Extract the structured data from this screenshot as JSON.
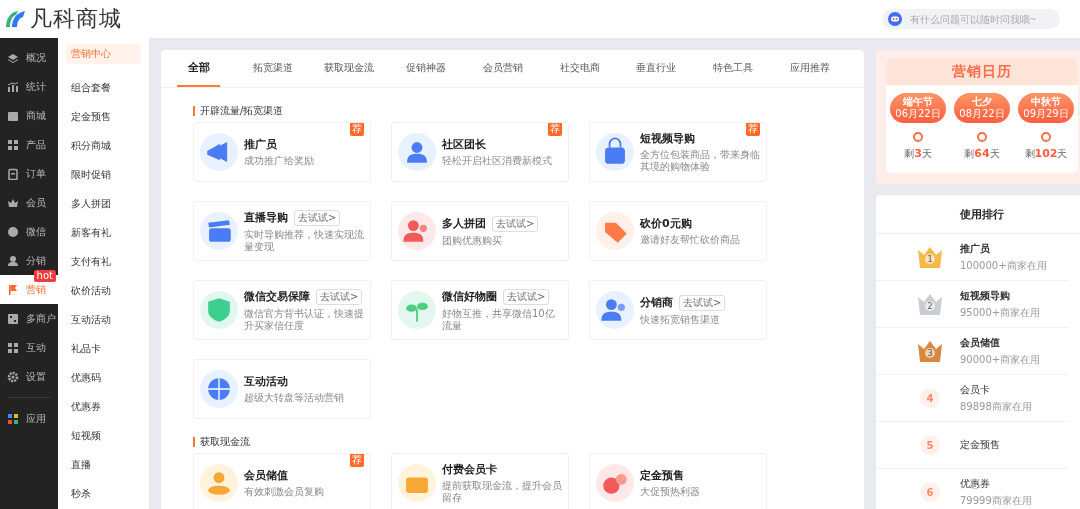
{
  "header": {
    "logo_text": "凡科商城",
    "search": {
      "placeholder": "有什么问题可以随时问我哦~"
    }
  },
  "nav": [
    {
      "label": "概况",
      "selected": false
    },
    {
      "label": "统计",
      "selected": false
    },
    {
      "label": "商城",
      "selected": false
    },
    {
      "label": "产品",
      "selected": false
    },
    {
      "label": "订单",
      "selected": false
    },
    {
      "label": "会员",
      "selected": false
    },
    {
      "label": "微信",
      "selected": false
    },
    {
      "label": "分销",
      "selected": false
    },
    {
      "label": "营销",
      "selected": true,
      "badge": "hot"
    },
    {
      "label": "多商户",
      "selected": false
    },
    {
      "label": "互动",
      "selected": false
    },
    {
      "label": "设置",
      "selected": false
    },
    {
      "label": "应用",
      "selected": false
    }
  ],
  "submenu": [
    {
      "label": "营销中心",
      "selected": true
    },
    {
      "label": "组合套餐",
      "selected": false
    },
    {
      "label": "定金预售",
      "selected": false
    },
    {
      "label": "积分商城",
      "selected": false
    },
    {
      "label": "限时促销",
      "selected": false
    },
    {
      "label": "多人拼团",
      "selected": false
    },
    {
      "label": "新客有礼",
      "selected": false
    },
    {
      "label": "支付有礼",
      "selected": false
    },
    {
      "label": "砍价活动",
      "selected": false
    },
    {
      "label": "互动活动",
      "selected": false
    },
    {
      "label": "礼品卡",
      "selected": false
    },
    {
      "label": "优惠码",
      "selected": false
    },
    {
      "label": "优惠券",
      "selected": false
    },
    {
      "label": "短视频",
      "selected": false
    },
    {
      "label": "直播",
      "selected": false
    },
    {
      "label": "秒杀",
      "selected": false
    }
  ],
  "tabs": [
    {
      "label": "全部",
      "selected": true
    },
    {
      "label": "拓宽渠道",
      "selected": false
    },
    {
      "label": "获取现金流",
      "selected": false
    },
    {
      "label": "促销神器",
      "selected": false
    },
    {
      "label": "会员营销",
      "selected": false
    },
    {
      "label": "社交电商",
      "selected": false
    },
    {
      "label": "垂直行业",
      "selected": false
    },
    {
      "label": "特色工具",
      "selected": false
    },
    {
      "label": "应用推荐",
      "selected": false
    }
  ],
  "sections": [
    {
      "title": "开辟流量/拓宽渠道",
      "cards": [
        {
          "title": "推广员",
          "description": "成功推广给奖励",
          "badge": "荐"
        },
        {
          "title": "社区团长",
          "description": "轻松开启社区消费新模式",
          "badge": "荐"
        },
        {
          "title": "短视频导购",
          "description": "全方位包装商品，带来身临其境的购物体验",
          "badge": "荐"
        },
        {
          "title": "直播导购",
          "description": "实时导购推荐，快速实现流量变现",
          "try_button": "去试试>"
        },
        {
          "title": "多人拼团",
          "description": "团购优惠购买",
          "try_button": "去试试>"
        },
        {
          "title": "砍价0元购",
          "description": "邀请好友帮忙砍价商品"
        },
        {
          "title": "微信交易保障",
          "description": "微信官方背书认证，快速提升买家信任度",
          "try_button": "去试试>"
        },
        {
          "title": "微信好物圈",
          "description": "好物互推，共享微信10亿流量",
          "try_button": "去试试>"
        },
        {
          "title": "分销商",
          "description": "快速拓宽销售渠道",
          "try_button": "去试试>"
        },
        {
          "title": "互动活动",
          "description": "超级大转盘等活动营销"
        }
      ]
    },
    {
      "title": "获取现金流",
      "cards": [
        {
          "title": "会员储值",
          "description": "有效刺激会员复购",
          "badge": "荐"
        },
        {
          "title": "付费会员卡",
          "description": "提前获取现金流，提升会员留存"
        },
        {
          "title": "定金预售",
          "description": "大促预热利器"
        }
      ]
    }
  ],
  "calendar": {
    "title": "营销日历",
    "festivals": [
      {
        "name": "端午节",
        "date": "06月22日",
        "remaining": "剩**3**天"
      },
      {
        "name": "七夕",
        "date": "08月22日",
        "remaining": "剩**64**天"
      },
      {
        "name": "中秋节",
        "date": "09月29日",
        "remaining": "剩**102**天"
      }
    ]
  },
  "ranking": {
    "title": "使用排行",
    "items": [
      {
        "kind": "crown",
        "rank": "1",
        "color": "#f5b94a",
        "name": "推广员",
        "count": "100000+商家在用"
      },
      {
        "kind": "crown",
        "rank": "2",
        "color": "#c9ccd3",
        "name": "短视频导购",
        "count": "95000+商家在用"
      },
      {
        "kind": "crown",
        "rank": "3",
        "color": "#d9893f",
        "name": "会员储值",
        "count": "90000+商家在用"
      },
      {
        "kind": "number",
        "rank": "4",
        "name": "会员卡",
        "count": "89898商家在用"
      },
      {
        "kind": "number",
        "rank": "5",
        "name": "定金预售"
      },
      {
        "kind": "number",
        "rank": "6",
        "name": "优惠券",
        "count": "79999商家在用"
      }
    ]
  }
}
